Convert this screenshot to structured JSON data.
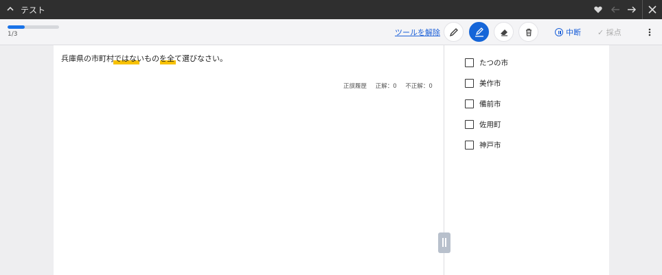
{
  "titlebar": {
    "title": "テスト"
  },
  "progress": {
    "text": "1/3",
    "fraction": 0.33
  },
  "toolbar": {
    "release_label": "ツールを解除",
    "pause_label": "中断",
    "score_label": "✓ 採点"
  },
  "question": {
    "text": "兵庫県の市町村ではないものを全て選びなさい。"
  },
  "history": {
    "label": "正誤履歴",
    "correct": "正解：0",
    "incorrect": "不正解：0"
  },
  "options": [
    {
      "label": "たつの市"
    },
    {
      "label": "美作市"
    },
    {
      "label": "備前市"
    },
    {
      "label": "佐用町"
    },
    {
      "label": "神戸市"
    }
  ],
  "colors": {
    "accent": "#1565d8",
    "highlight": "#f7c100",
    "titlebar": "#2f2f2f"
  },
  "icons": [
    "chevron-up-icon",
    "heart-icon",
    "arrow-left-icon",
    "arrow-right-icon",
    "close-icon",
    "pencil-icon",
    "marker-icon",
    "eraser-icon",
    "trash-icon",
    "pause-icon",
    "kebab-menu-icon"
  ]
}
